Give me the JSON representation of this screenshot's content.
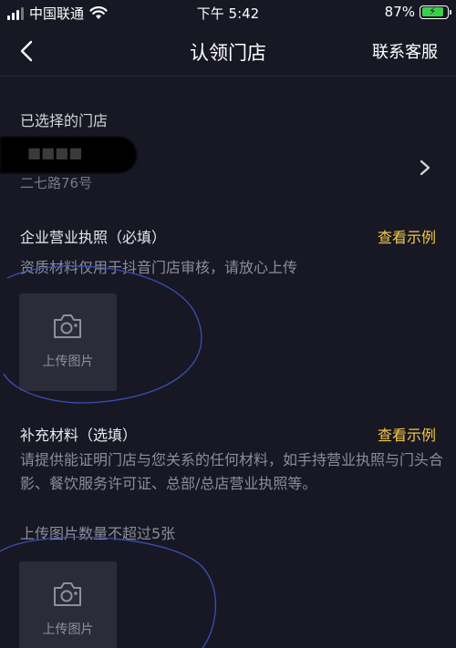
{
  "status_bar": {
    "carrier": "中国联通",
    "time": "下午 5:42",
    "battery": "87%"
  },
  "nav": {
    "title": "认领门店",
    "support_label": "联系客服"
  },
  "store": {
    "section_label": "已选择的门店",
    "name": "■■■■",
    "address": "二七路76号"
  },
  "license": {
    "title": "企业营业执照（必填）",
    "example_label": "查看示例",
    "hint": "资质材料仅用于抖音门店审核，请放心上传",
    "upload_label": "上传图片"
  },
  "supplementary": {
    "title": "补充材料（选填）",
    "example_label": "查看示例",
    "hint": "请提供能证明门店与您关系的任何材料，如手持营业执照与门头合影、餐饮服务许可证、总部/总店营业执照等。",
    "limit": "上传图片数量不超过5张",
    "upload_label": "上传图片"
  },
  "colors": {
    "background": "#171823",
    "accent": "#f4c84a",
    "upload_box": "#2b2c37"
  }
}
